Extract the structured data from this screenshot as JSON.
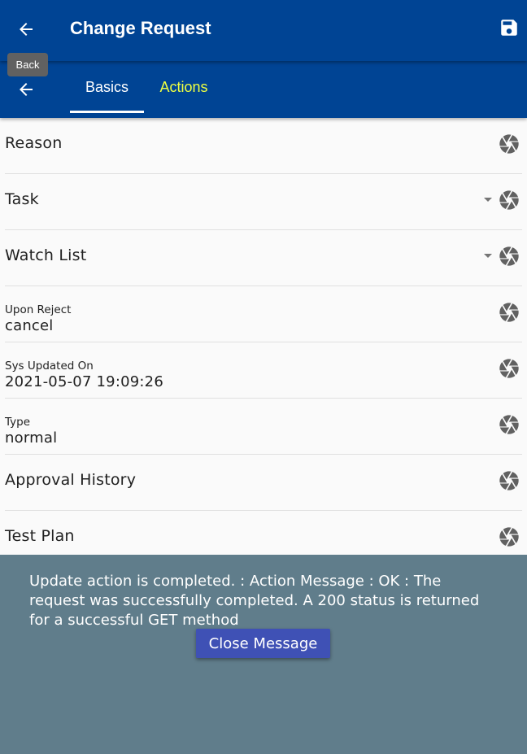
{
  "appbar": {
    "title": "Change Request",
    "back_icon": "arrow-left-icon",
    "save_icon": "save-floppy-icon"
  },
  "tooltip": {
    "text": "Back"
  },
  "tabs": [
    {
      "label": "Basics",
      "active": true
    },
    {
      "label": "Actions",
      "active": false
    }
  ],
  "fields": [
    {
      "label": "Reason"
    },
    {
      "label": "Task",
      "dropdown": true
    },
    {
      "label": "Watch List",
      "dropdown": true
    },
    {
      "label": "Upon Reject",
      "value": "cancel"
    },
    {
      "label": "Sys Updated On",
      "value": "2021-05-07 19:09:26"
    },
    {
      "label": "Type",
      "value": "normal"
    },
    {
      "label": "Approval History"
    },
    {
      "label": "Test Plan"
    }
  ],
  "message": {
    "text": "Update action is completed.  : Action Message : OK : The request was successfully completed. A 200 status is returned for a successful GET method",
    "close_label": "Close Message"
  },
  "colors": {
    "primary": "#004494",
    "active_tab": "#ffffff",
    "inactive_tab": "#eeff41",
    "overlay": "#607d8b",
    "button": "#3f51b5"
  }
}
